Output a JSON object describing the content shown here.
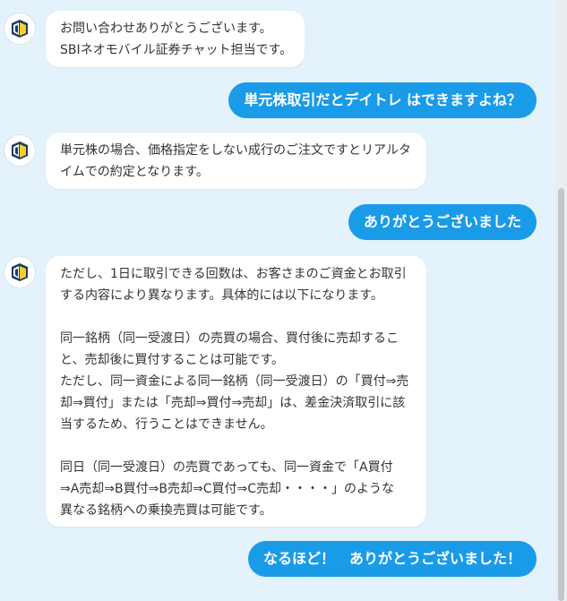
{
  "messages": [
    {
      "from": "bot",
      "lines": [
        "お問い合わせありがとうございます。",
        "SBIネオモバイル証券チャット担当です。"
      ]
    },
    {
      "from": "user",
      "text": "単元株取引だとデイトレ はできますよね？"
    },
    {
      "from": "bot",
      "lines": [
        "単元株の場合、価格指定をしない成行のご注文ですとリアルタ",
        "イムでの約定となります。"
      ]
    },
    {
      "from": "user",
      "text": "ありがとうございました"
    },
    {
      "from": "bot",
      "lines": [
        "ただし、1日に取引できる回数は、お客さまのご資金とお取引",
        "する内容により異なります。具体的には以下になります。",
        "",
        "同一銘柄（同一受渡日）の売買の場合、買付後に売却するこ",
        "と、売却後に買付することは可能です。",
        "ただし、同一資金による同一銘柄（同一受渡日）の「買付⇒売",
        "却⇒買付」または「売却⇒買付⇒売却」は、差金決済取引に該",
        "当するため、行うことはできません。",
        "",
        "同日（同一受渡日）の売買であっても、同一資金で「A買付",
        "⇒A売却⇒B買付⇒B売却⇒C買付⇒C売却・・・・」のような",
        "異なる銘柄への乗換売買は可能です。"
      ]
    },
    {
      "from": "user",
      "text": "なるほど！　ありがとうございました！"
    }
  ],
  "colors": {
    "background": "#e4f2fc",
    "user_bubble": "#1a9be8",
    "bot_bubble": "#ffffff"
  },
  "icons": {
    "avatar": "sbi-neomobile-logo-icon"
  }
}
